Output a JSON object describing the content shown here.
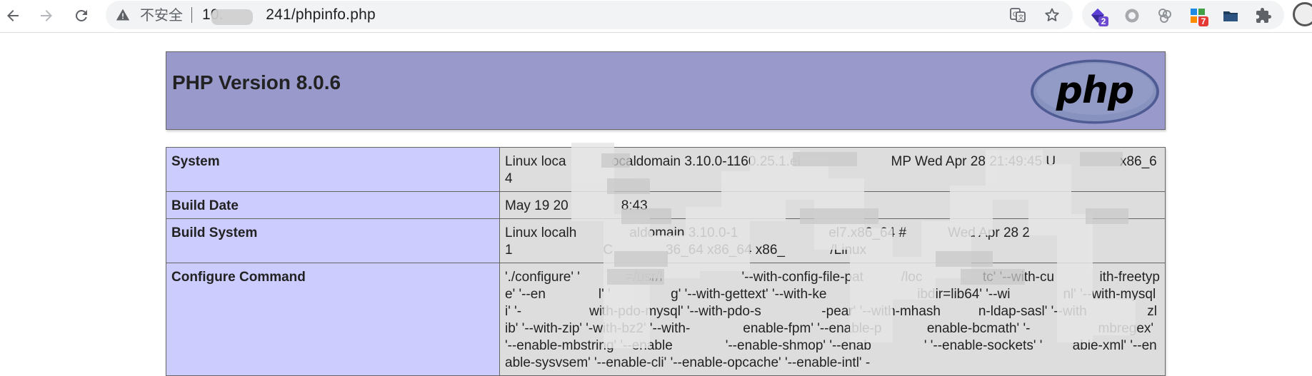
{
  "browser": {
    "security_status": "不安全",
    "url": "10.     241/phpinfo.php",
    "extensions": [
      {
        "name": "purple-gem-extension-icon",
        "badge": "2",
        "badge_color": "#6c4bd1"
      },
      {
        "name": "circle-extension-icon"
      },
      {
        "name": "multi-circle-extension-icon"
      },
      {
        "name": "grid-extension-icon",
        "badge": "7",
        "badge_color": "#e53935"
      },
      {
        "name": "folder-extension-icon"
      },
      {
        "name": "puzzle-extensions-icon"
      }
    ]
  },
  "phpinfo": {
    "version_title": "PHP Version 8.0.6",
    "logo_text": "php",
    "rows": [
      {
        "label": "System",
        "value": "Linux loca      ocaldomain 3.10.0-1160.25.1.el            MP Wed Apr 28 21:49:45 U         x86_64"
      },
      {
        "label": "Build Date",
        "value": "May 19 20       8:43"
      },
      {
        "label": "Build System",
        "value": "Linux localh       aldomain 3.10.0-1            el7.x86_64 #      Wed Apr 28 21            C       36_64 x86_64 x86_      /Linux"
      },
      {
        "label": "Configure Command",
        "value": "'./configure' '      =/usr/l           '--with-config-file-pat     /loc        tc' '--with-cu      ith-freetype' '--en       l' '        g' '--with-gettext' '--with-ke            ibdir=lib64' '--wi       nl' '--with-mysqli' '-         with-pdo-mysql' '--with-pdo-s        -pear' '--with-mhash     n-ldap-sasl' '--with        zlib' '--with-zip' '-with-bz2' '--with-       enable-fpm' '--enable-p      enable-bcmath' '-         mbregex' '--enable-mbstring' '--enable       '--enable-shmop' '--enab       ' '--enable-sockets' '    able-xml' '--enable-sysvsem' '--enable-cli' '--enable-opcache' '--enable-intl' -"
      }
    ]
  }
}
